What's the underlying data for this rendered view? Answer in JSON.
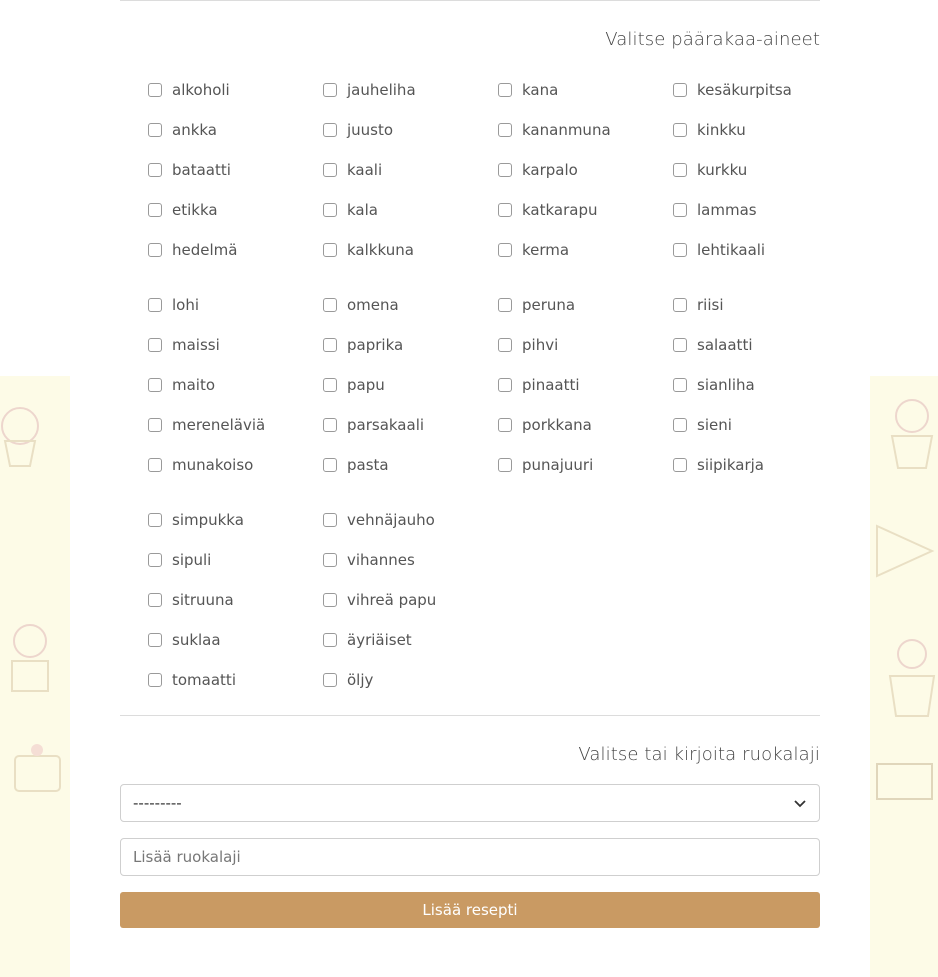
{
  "ingredients_section": {
    "title": "Valitse päärakaa-aineet",
    "groups": [
      [
        [
          "alkoholi",
          "jauheliha",
          "kana",
          "kesäkurpitsa"
        ],
        [
          "ankka",
          "juusto",
          "kananmuna",
          "kinkku"
        ],
        [
          "bataatti",
          "kaali",
          "karpalo",
          "kurkku"
        ],
        [
          "etikka",
          "kala",
          "katkarapu",
          "lammas"
        ],
        [
          "hedelmä",
          "kalkkuna",
          "kerma",
          "lehtikaali"
        ]
      ],
      [
        [
          "lohi",
          "omena",
          "peruna",
          "riisi"
        ],
        [
          "maissi",
          "paprika",
          "pihvi",
          "salaatti"
        ],
        [
          "maito",
          "papu",
          "pinaatti",
          "sianliha"
        ],
        [
          "mereneläviä",
          "parsakaali",
          "porkkana",
          "sieni"
        ],
        [
          "munakoiso",
          "pasta",
          "punajuuri",
          "siipikarja"
        ]
      ],
      [
        [
          "simpukka",
          "vehnäjauho"
        ],
        [
          "sipuli",
          "vihannes"
        ],
        [
          "sitruuna",
          "vihreä papu"
        ],
        [
          "suklaa",
          "äyriäiset"
        ],
        [
          "tomaatti",
          "öljy"
        ]
      ]
    ]
  },
  "dish_section": {
    "title": "Valitse tai kirjoita ruokalaji",
    "select_value": "---------",
    "input_placeholder": "Lisää ruokalaji",
    "submit_label": "Lisää resepti"
  },
  "colors": {
    "accent": "#c99a63",
    "background_pattern": "#fdfbe7"
  }
}
